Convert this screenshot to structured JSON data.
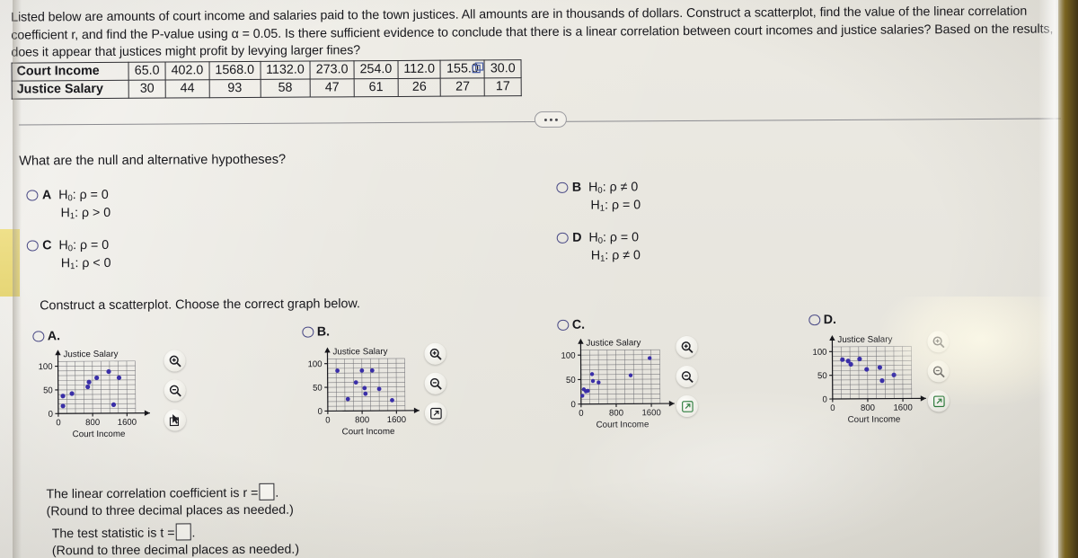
{
  "statement": {
    "text": "Listed below are amounts of court income and salaries paid to the town justices. All amounts are in thousands of dollars. Construct a scatterplot, find the value of the linear correlation coefficient r, and find the P-value using α = 0.05. Is there sufficient evidence to conclude that there is a linear correlation between court incomes and justice salaries? Based on the results, does it appear that justices might profit by levying larger fines?"
  },
  "data_table": {
    "row_labels": [
      "Court Income",
      "Justice Salary"
    ],
    "court_income": [
      "65.0",
      "402.0",
      "1568.0",
      "1132.0",
      "273.0",
      "254.0",
      "112.0",
      "155.0",
      "30.0"
    ],
    "justice_salary": [
      "30",
      "44",
      "93",
      "58",
      "47",
      "61",
      "26",
      "27",
      "17"
    ],
    "copy_icon": "copy-icon"
  },
  "divider": {
    "ellipsis": "..."
  },
  "questions": {
    "hypotheses_prompt": "What are the null and alternative hypotheses?",
    "scatterplot_prompt": "Construct a scatterplot. Choose the correct graph below."
  },
  "hypothesis_choices": [
    {
      "key": "A",
      "line1_h0": "H",
      "line1_sub": "0",
      "line1_rest": ": ρ = 0",
      "line2_h1": "H",
      "line2_sub": "1",
      "line2_rest": ": ρ > 0"
    },
    {
      "key": "B",
      "line1_h0": "H",
      "line1_sub": "0",
      "line1_rest": ": ρ ≠ 0",
      "line2_h1": "H",
      "line2_sub": "1",
      "line2_rest": ": ρ = 0"
    },
    {
      "key": "C",
      "line1_h0": "H",
      "line1_sub": "0",
      "line1_rest": ": ρ = 0",
      "line2_h1": "H",
      "line2_sub": "1",
      "line2_rest": ": ρ < 0"
    },
    {
      "key": "D",
      "line1_h0": "H",
      "line1_sub": "0",
      "line1_rest": ": ρ = 0",
      "line2_h1": "H",
      "line2_sub": "1",
      "line2_rest": ": ρ ≠ 0"
    }
  ],
  "graph_options": [
    {
      "key": "A",
      "tools": [
        "zoom-in-icon",
        "zoom-out-icon",
        "cursor-select-icon"
      ]
    },
    {
      "key": "B",
      "tools": [
        "zoom-in-icon",
        "zoom-out-icon",
        "open-in-new-icon"
      ]
    },
    {
      "key": "C",
      "tools": [
        "zoom-in-icon",
        "zoom-out-icon",
        "open-in-new-icon"
      ]
    },
    {
      "key": "D",
      "tools": [
        "zoom-in-icon",
        "zoom-out-icon",
        "open-in-new-icon"
      ]
    }
  ],
  "answers": {
    "r_line1_pre": "The linear correlation coefficient is r =",
    "r_line1_post": ".",
    "r_line2": "(Round to three decimal places as needed.)",
    "t_line1_pre": "The test statistic is t =",
    "t_line1_post": ".",
    "t_line2": "(Round to three decimal places as needed.)",
    "r_value": "",
    "t_value": ""
  },
  "colors": {
    "point": "#3a2fa8",
    "radio_border": "#4a4a86",
    "text": "#17171c",
    "grid": "#6e6e74",
    "page_bg": "#e9e7e0"
  },
  "chart_data": [
    {
      "id": "A",
      "type": "scatter",
      "title": "",
      "xlabel": "Court Income",
      "ylabel": "Justice Salary",
      "xlim": [
        0,
        1800
      ],
      "ylim": [
        0,
        110
      ],
      "xticks": [
        0,
        800,
        1600
      ],
      "yticks": [
        0,
        50,
        100
      ],
      "grid": true,
      "points": [
        {
          "x": 110,
          "y": 37
        },
        {
          "x": 110,
          "y": 16
        },
        {
          "x": 320,
          "y": 42
        },
        {
          "x": 690,
          "y": 56
        },
        {
          "x": 720,
          "y": 66
        },
        {
          "x": 900,
          "y": 75
        },
        {
          "x": 1180,
          "y": 88
        },
        {
          "x": 1290,
          "y": 18
        },
        {
          "x": 1420,
          "y": 75
        }
      ]
    },
    {
      "id": "B",
      "type": "scatter",
      "title": "",
      "xlabel": "Court Income",
      "ylabel": "Justice Salary",
      "xlim": [
        0,
        1800
      ],
      "ylim": [
        0,
        110
      ],
      "xticks": [
        0,
        800,
        1600
      ],
      "yticks": [
        0,
        50,
        100
      ],
      "grid": true,
      "points": [
        {
          "x": 230,
          "y": 85
        },
        {
          "x": 470,
          "y": 25
        },
        {
          "x": 660,
          "y": 60
        },
        {
          "x": 800,
          "y": 85
        },
        {
          "x": 860,
          "y": 48
        },
        {
          "x": 880,
          "y": 36
        },
        {
          "x": 1040,
          "y": 85
        },
        {
          "x": 1200,
          "y": 46
        },
        {
          "x": 1500,
          "y": 22
        }
      ]
    },
    {
      "id": "C",
      "type": "scatter",
      "title": "",
      "xlabel": "Court Income",
      "ylabel": "Justice Salary",
      "xlim": [
        0,
        1800
      ],
      "ylim": [
        0,
        110
      ],
      "xticks": [
        0,
        800,
        1600
      ],
      "yticks": [
        0,
        50,
        100
      ],
      "grid": true,
      "points": [
        {
          "x": 30,
          "y": 17
        },
        {
          "x": 65,
          "y": 30
        },
        {
          "x": 112,
          "y": 26
        },
        {
          "x": 155,
          "y": 27
        },
        {
          "x": 254,
          "y": 61
        },
        {
          "x": 273,
          "y": 47
        },
        {
          "x": 402,
          "y": 44
        },
        {
          "x": 1132,
          "y": 58
        },
        {
          "x": 1568,
          "y": 93
        }
      ]
    },
    {
      "id": "D",
      "type": "scatter",
      "title": "",
      "xlabel": "Court Income",
      "ylabel": "Justice Salary",
      "xlim": [
        0,
        1800
      ],
      "ylim": [
        0,
        110
      ],
      "xticks": [
        0,
        800,
        1600
      ],
      "yticks": [
        0,
        50,
        100
      ],
      "grid": true,
      "points": [
        {
          "x": 230,
          "y": 83
        },
        {
          "x": 360,
          "y": 80
        },
        {
          "x": 420,
          "y": 73
        },
        {
          "x": 620,
          "y": 84
        },
        {
          "x": 780,
          "y": 62
        },
        {
          "x": 1080,
          "y": 66
        },
        {
          "x": 1130,
          "y": 38
        },
        {
          "x": 1400,
          "y": 50
        }
      ]
    }
  ]
}
